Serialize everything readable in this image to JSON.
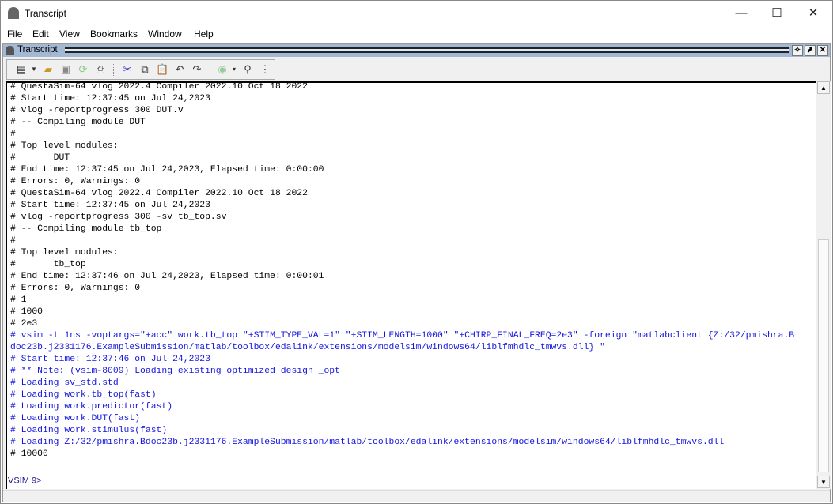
{
  "window": {
    "title": "Transcript",
    "minimize": "—",
    "maximize": "☐",
    "close": "✕"
  },
  "menu": [
    "File",
    "Edit",
    "View",
    "Bookmarks",
    "Window",
    "Help"
  ],
  "panel": {
    "title": "Transcript",
    "btn_undock": "✧",
    "btn_float": "⬈",
    "btn_close": "✕"
  },
  "toolbar": [
    "new-file",
    "open-folder",
    "save",
    "reload",
    "print",
    "cut",
    "copy",
    "paste",
    "undo",
    "redo",
    "break",
    "find",
    "find-options"
  ],
  "transcript": {
    "lines": [
      {
        "text": "# QuestaSim-64 vlog 2022.4 Compiler 2022.10 Oct 18 2022",
        "color": "black"
      },
      {
        "text": "# Start time: 12:37:45 on Jul 24,2023",
        "color": "black"
      },
      {
        "text": "# vlog -reportprogress 300 DUT.v",
        "color": "black"
      },
      {
        "text": "# -- Compiling module DUT",
        "color": "black"
      },
      {
        "text": "#",
        "color": "black"
      },
      {
        "text": "# Top level modules:",
        "color": "black"
      },
      {
        "text": "#       DUT",
        "color": "black"
      },
      {
        "text": "# End time: 12:37:45 on Jul 24,2023, Elapsed time: 0:00:00",
        "color": "black"
      },
      {
        "text": "# Errors: 0, Warnings: 0",
        "color": "black"
      },
      {
        "text": "# QuestaSim-64 vlog 2022.4 Compiler 2022.10 Oct 18 2022",
        "color": "black"
      },
      {
        "text": "# Start time: 12:37:45 on Jul 24,2023",
        "color": "black"
      },
      {
        "text": "# vlog -reportprogress 300 -sv tb_top.sv",
        "color": "black"
      },
      {
        "text": "# -- Compiling module tb_top",
        "color": "black"
      },
      {
        "text": "#",
        "color": "black"
      },
      {
        "text": "# Top level modules:",
        "color": "black"
      },
      {
        "text": "#       tb_top",
        "color": "black"
      },
      {
        "text": "# End time: 12:37:46 on Jul 24,2023, Elapsed time: 0:00:01",
        "color": "black"
      },
      {
        "text": "# Errors: 0, Warnings: 0",
        "color": "black"
      },
      {
        "text": "# 1",
        "color": "black"
      },
      {
        "text": "# 1000",
        "color": "black"
      },
      {
        "text": "# 2e3",
        "color": "black"
      },
      {
        "text": "# vsim -t 1ns -voptargs=\"+acc\" work.tb_top \"+STIM_TYPE_VAL=1\" \"+STIM_LENGTH=1000\" \"+CHIRP_FINAL_FREQ=2e3\" -foreign \"matlabclient {Z:/32/pmishra.B",
        "color": "blue"
      },
      {
        "text": "doc23b.j2331176.ExampleSubmission/matlab/toolbox/edalink/extensions/modelsim/windows64/liblfmhdlc_tmwvs.dll} \"",
        "color": "blue"
      },
      {
        "text": "# Start time: 12:37:46 on Jul 24,2023",
        "color": "blue"
      },
      {
        "text": "# ** Note: (vsim-8009) Loading existing optimized design _opt",
        "color": "blue"
      },
      {
        "text": "# Loading sv_std.std",
        "color": "blue"
      },
      {
        "text": "# Loading work.tb_top(fast)",
        "color": "blue"
      },
      {
        "text": "# Loading work.predictor(fast)",
        "color": "blue"
      },
      {
        "text": "# Loading work.DUT(fast)",
        "color": "blue"
      },
      {
        "text": "# Loading work.stimulus(fast)",
        "color": "blue"
      },
      {
        "text": "# Loading Z:/32/pmishra.Bdoc23b.j2331176.ExampleSubmission/matlab/toolbox/edalink/extensions/modelsim/windows64/liblfmhdlc_tmwvs.dll",
        "color": "blue"
      },
      {
        "text": "# 10000",
        "color": "black"
      }
    ],
    "prompt": "VSIM 9>"
  },
  "scroll": {
    "up": "▲",
    "down": "▼"
  }
}
